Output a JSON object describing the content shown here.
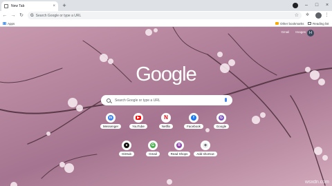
{
  "tab": {
    "title": "New Tab",
    "close": "×"
  },
  "new_tab": "+",
  "window_controls": {
    "minimize": "–",
    "maximize": "□",
    "close": "×"
  },
  "toolbar": {
    "back": "←",
    "forward": "→",
    "reload": "↻",
    "omnibox_placeholder": "Search Google or type a URL",
    "star": "☆"
  },
  "bookmarks": {
    "apps": "Apps",
    "other": "Other bookmarks",
    "reading": "Reading list"
  },
  "page": {
    "links": [
      "Gmail",
      "Images"
    ],
    "profile_initial": "H",
    "logo": "Google",
    "search_placeholder": "Search Google or type a URL",
    "shortcuts_row1": [
      {
        "label": "Messenger",
        "glyph": "m",
        "color": "#3b82f6"
      },
      {
        "label": "YouTube",
        "glyph": "▶",
        "color": "#ff0000"
      },
      {
        "label": "Netflix",
        "glyph": "N",
        "color": "#e50914"
      },
      {
        "label": "Facebook",
        "glyph": "f",
        "color": "#1877f2"
      },
      {
        "label": "Google",
        "glyph": "G",
        "color": "#7e57c2"
      }
    ],
    "shortcuts_row2": [
      {
        "label": "GitHub",
        "glyph": "●",
        "color": "#111111"
      },
      {
        "label": "Gmail",
        "glyph": "G",
        "color": "#4caf50"
      },
      {
        "label": "Read Shops",
        "glyph": "R",
        "color": "#8e44ad"
      },
      {
        "label": "Add shortcut",
        "glyph": "+",
        "color": "#e8eaed"
      }
    ]
  },
  "watermark": "wsxdn.com"
}
